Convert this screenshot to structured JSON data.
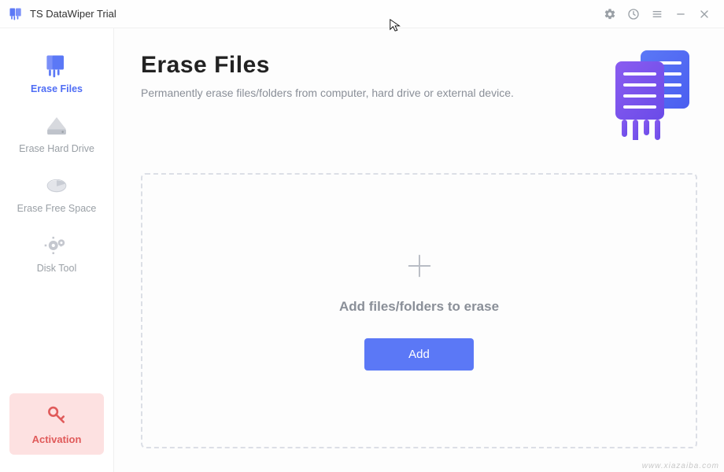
{
  "app": {
    "title": "TS DataWiper Trial"
  },
  "titlebar": {
    "icons": [
      "settings",
      "clock",
      "menu",
      "minimize",
      "close"
    ]
  },
  "sidebar": {
    "items": [
      {
        "label": "Erase Files",
        "icon": "files-icon",
        "active": true
      },
      {
        "label": "Erase Hard Drive",
        "icon": "hdd-icon",
        "active": false
      },
      {
        "label": "Erase Free Space",
        "icon": "pie-icon",
        "active": false
      },
      {
        "label": "Disk Tool",
        "icon": "gears-icon",
        "active": false
      }
    ],
    "activation": {
      "label": "Activation"
    }
  },
  "main": {
    "title": "Erase Files",
    "subtitle": "Permanently erase files/folders from computer, hard drive or external device.",
    "dropzone_label": "Add files/folders to erase",
    "add_button": "Add"
  },
  "watermark": "www.xiazaiba.com"
}
